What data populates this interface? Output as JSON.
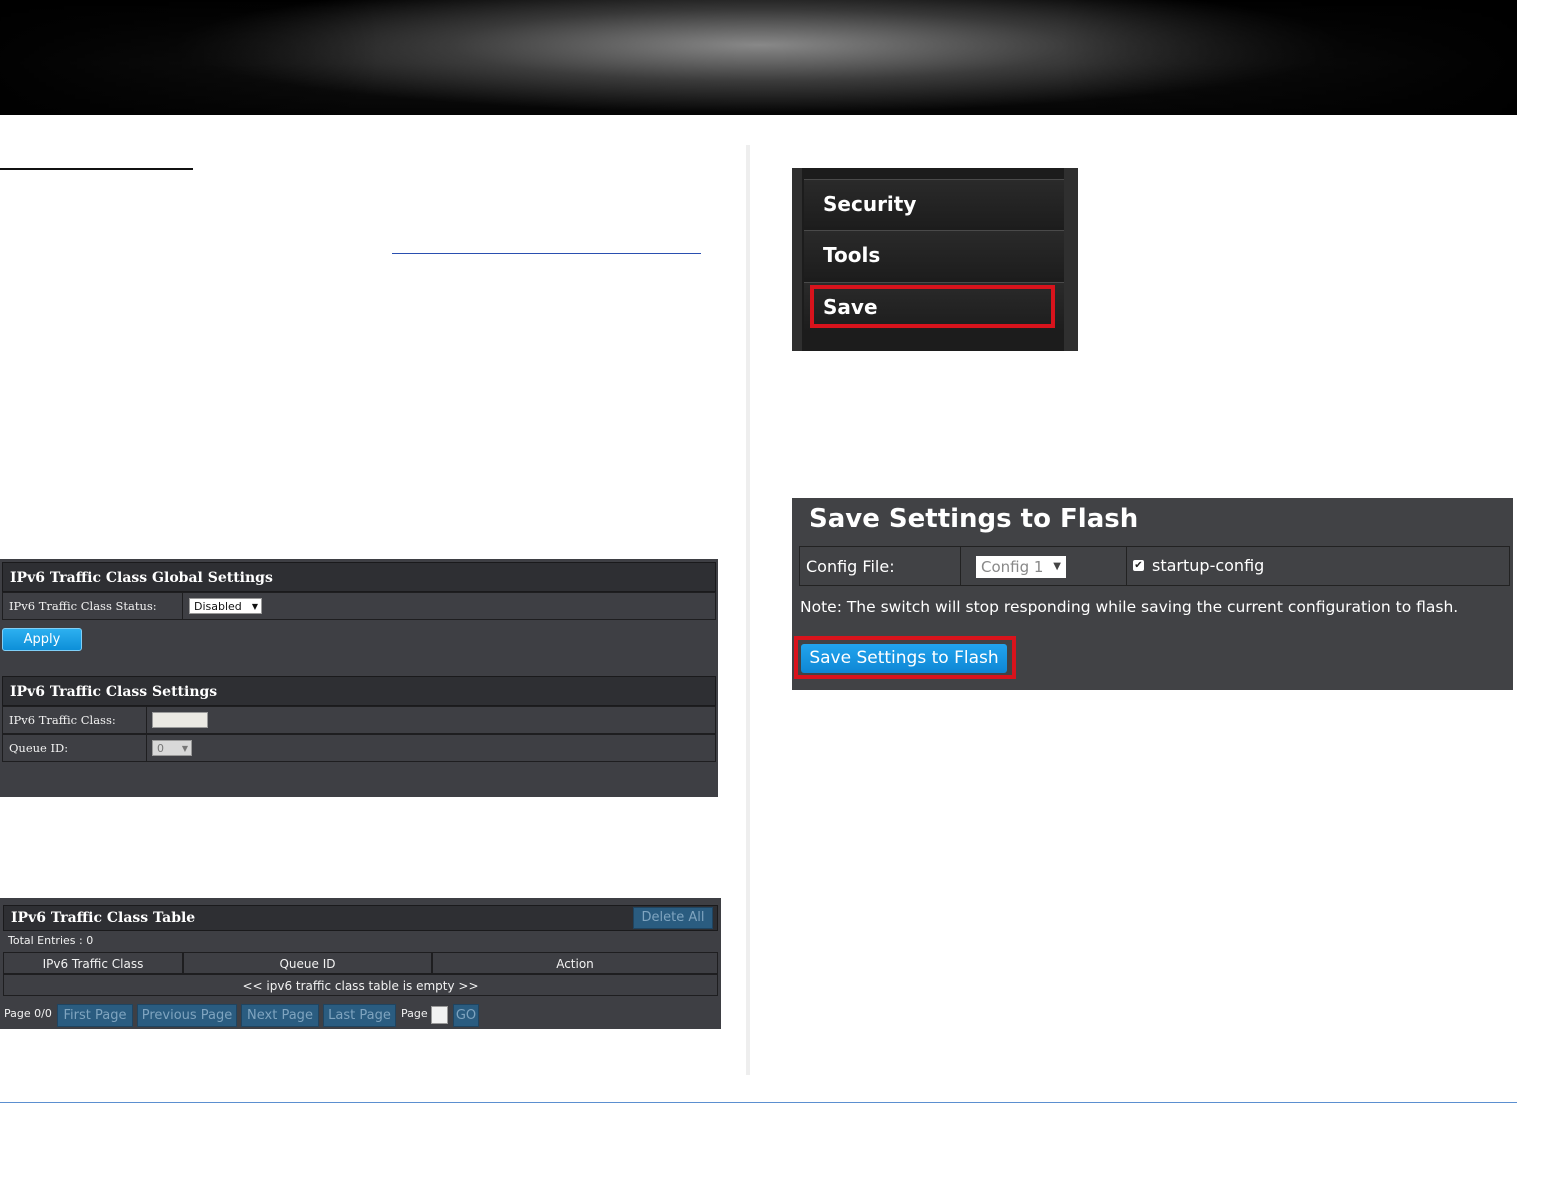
{
  "panel_global": {
    "title": "IPv6 Traffic Class Global Settings",
    "status_label": "IPv6 Traffic Class Status:",
    "status_value": "Disabled",
    "apply_label": "Apply"
  },
  "panel_settings": {
    "title": "IPv6 Traffic Class Settings",
    "class_label": "IPv6 Traffic Class:",
    "queue_label": "Queue ID:",
    "queue_value": "0"
  },
  "panel_table": {
    "title": "IPv6 Traffic Class Table",
    "delete_all_label": "Delete All",
    "total_entries": "Total Entries : 0",
    "columns": [
      "IPv6 Traffic Class",
      "Queue ID",
      "Action"
    ],
    "empty_message": "<< ipv6 traffic class table is empty >>",
    "page_status": "Page 0/0",
    "first_page": "First Page",
    "previous_page": "Previous Page",
    "next_page": "Next Page",
    "last_page": "Last Page",
    "page_label": "Page",
    "go_label": "GO"
  },
  "side_menu": {
    "items": [
      "Security",
      "Tools",
      "Save"
    ],
    "highlight_color": "#d8131c"
  },
  "save_panel": {
    "title": "Save Settings to Flash",
    "config_label": "Config File:",
    "config_value": "Config 1",
    "checkbox_label": "startup-config",
    "checkbox_checked": true,
    "note": "Note: The switch will stop responding while saving the current configuration to flash.",
    "button_label": "Save Settings to Flash"
  }
}
